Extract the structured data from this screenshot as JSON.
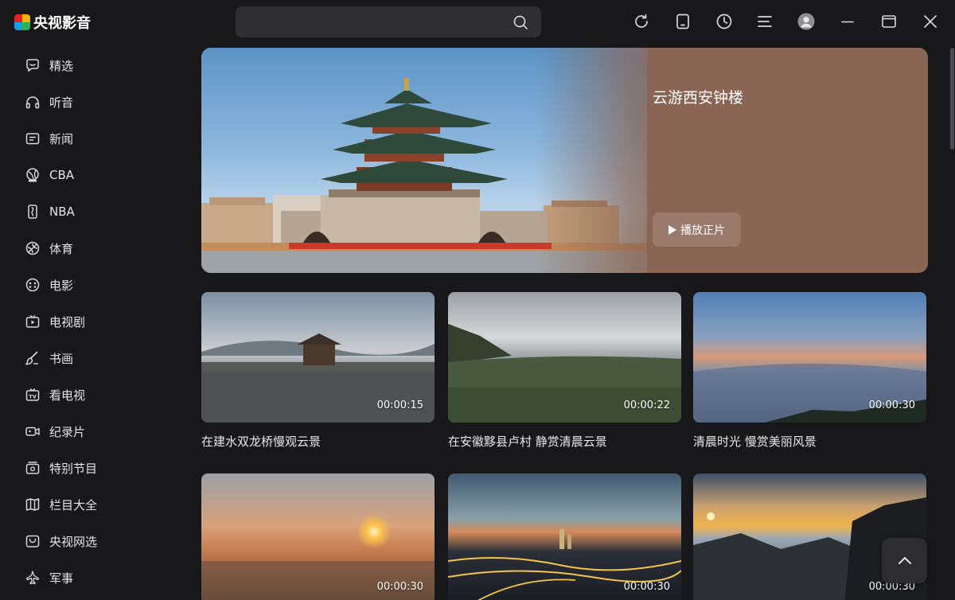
{
  "app": {
    "logo_text": "央视影音"
  },
  "search": {
    "value": "",
    "placeholder": ""
  },
  "sidebar": {
    "items": [
      {
        "label": "精选",
        "icon": "chat-bubble-icon"
      },
      {
        "label": "听音",
        "icon": "headphones-icon"
      },
      {
        "label": "新闻",
        "icon": "news-icon"
      },
      {
        "label": "CBA",
        "icon": "cba-logo-icon"
      },
      {
        "label": "NBA",
        "icon": "nba-logo-icon"
      },
      {
        "label": "体育",
        "icon": "sports-ball-icon"
      },
      {
        "label": "电影",
        "icon": "film-reel-icon"
      },
      {
        "label": "电视剧",
        "icon": "tv-play-icon"
      },
      {
        "label": "书画",
        "icon": "brush-icon"
      },
      {
        "label": "看电视",
        "icon": "tv-icon"
      },
      {
        "label": "纪录片",
        "icon": "video-camera-icon"
      },
      {
        "label": "特别节目",
        "icon": "special-program-icon"
      },
      {
        "label": "栏目大全",
        "icon": "map-icon"
      },
      {
        "label": "央视网选",
        "icon": "shopping-icon"
      },
      {
        "label": "军事",
        "icon": "jet-icon"
      }
    ]
  },
  "hero": {
    "title": "云游西安钟楼",
    "play_label": "播放正片"
  },
  "videos": [
    {
      "title": "在建水双龙桥慢观云景",
      "duration": "00:00:15"
    },
    {
      "title": "在安徽黟县卢村 静赏清晨云景",
      "duration": "00:00:22"
    },
    {
      "title": "清晨时光 慢赏美丽风景",
      "duration": "00:00:30"
    },
    {
      "title": "",
      "duration": "00:00:30"
    },
    {
      "title": "",
      "duration": "00:00:30"
    },
    {
      "title": "",
      "duration": "00:00:30"
    }
  ],
  "colors": {
    "background": "#18181b",
    "hero_panel": "#8a6553",
    "search_bg": "#2e2e33"
  }
}
